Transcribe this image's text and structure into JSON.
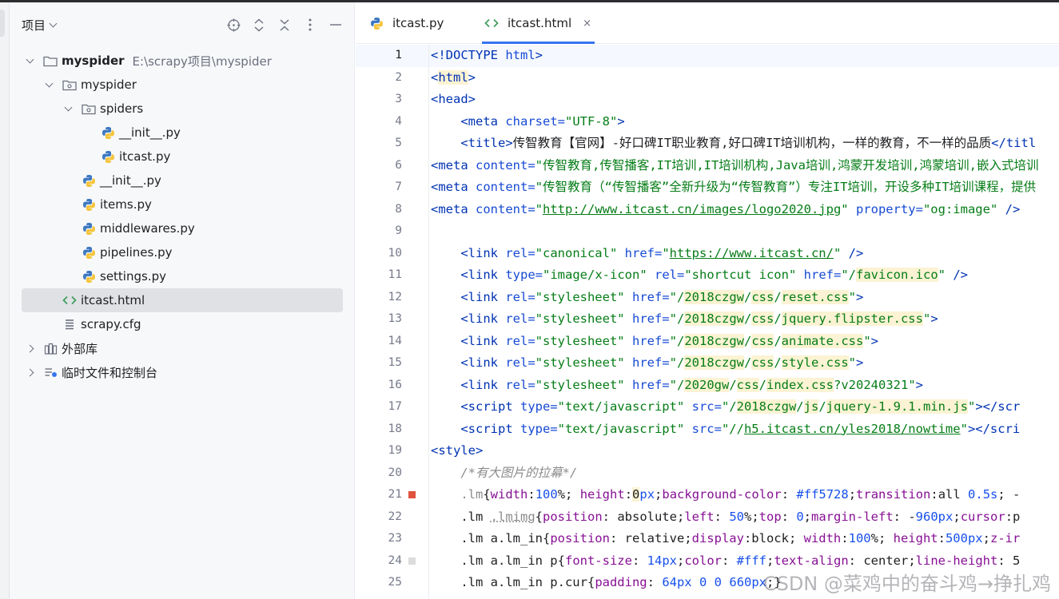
{
  "project_panel": {
    "title": "项目",
    "header_icons": [
      "crosshair-icon",
      "expand-collapse-icon",
      "close-icon",
      "more-icon",
      "minimize-icon"
    ],
    "tree": [
      {
        "label": "myspider",
        "hint": "E:\\scrapy项目\\myspider",
        "type": "folder",
        "expanded": true
      },
      {
        "label": "myspider",
        "type": "package",
        "expanded": true
      },
      {
        "label": "spiders",
        "type": "package",
        "expanded": true
      },
      {
        "label": "__init__.py",
        "type": "python-file"
      },
      {
        "label": "itcast.py",
        "type": "python-file"
      },
      {
        "label": "__init__.py",
        "type": "python-file"
      },
      {
        "label": "items.py",
        "type": "python-file"
      },
      {
        "label": "middlewares.py",
        "type": "python-file"
      },
      {
        "label": "pipelines.py",
        "type": "python-file"
      },
      {
        "label": "settings.py",
        "type": "python-file"
      },
      {
        "label": "itcast.html",
        "type": "html-file",
        "selected": true
      },
      {
        "label": "scrapy.cfg",
        "type": "config-file"
      },
      {
        "label": "外部库",
        "type": "library",
        "expanded": false
      },
      {
        "label": "临时文件和控制台",
        "type": "scratches",
        "expanded": false
      }
    ]
  },
  "tabs": [
    {
      "label": "itcast.py",
      "icon": "python-icon",
      "active": false
    },
    {
      "label": "itcast.html",
      "icon": "html-icon",
      "active": true,
      "close": "×"
    }
  ],
  "editor": {
    "line_numbers": [
      "1",
      "2",
      "3",
      "4",
      "5",
      "6",
      "7",
      "8",
      "9",
      "10",
      "11",
      "12",
      "13",
      "14",
      "15",
      "16",
      "17",
      "18",
      "19",
      "20",
      "21",
      "22",
      "23",
      "24",
      "25"
    ],
    "current_line": 1,
    "breakpoint_colors": {
      "21": "#e0533d",
      "24": "#dcdcdc"
    },
    "code_lines": [
      "<!DOCTYPE html>",
      "<html>",
      "<head>",
      "    <meta charset=\"UTF-8\">",
      "    <title>传智教育【官网】-好口碑IT职业教育,好口碑IT培训机构，一样的教育，不一样的品质</titl",
      "<meta content=\"传智教育,传智播客,IT培训,IT培训机构,Java培训,鸿蒙开发培训,鸿蒙培训,嵌入式培训",
      "<meta content=\"传智教育（“传智播客”全新升级为“传智教育”）专注IT培训，开设多种IT培训课程，提供",
      "<meta content=\"http://www.itcast.cn/images/logo2020.jpg\" property=\"og:image\" />",
      "",
      "    <link rel=\"canonical\" href=\"https://www.itcast.cn/\" />",
      "    <link type=\"image/x-icon\" rel=\"shortcut icon\" href=\"/favicon.ico\" />",
      "    <link rel=\"stylesheet\" href=\"/2018czgw/css/reset.css\">",
      "    <link rel=\"stylesheet\" href=\"/2018czgw/css/jquery.flipster.css\">",
      "    <link rel=\"stylesheet\" href=\"/2018czgw/css/animate.css\">",
      "    <link rel=\"stylesheet\" href=\"/2018czgw/css/style.css\">",
      "    <link rel=\"stylesheet\" href=\"/2020gw/css/index.css?v20240321\">",
      "    <script type=\"text/javascript\" src=\"/2018czgw/js/jquery-1.9.1.min.js\"></scr",
      "    <script type=\"text/javascript\" src=\"//h5.itcast.cn/yles2018/nowtime\"></scri",
      "<style>",
      "    /*有大图片的拉幕*/",
      "    .lm{width:100%; height:0px;background-color: #ff5728;transition:all 0.5s; -",
      "    .lm .lmimg{position: absolute;left: 50%;top: 0;margin-left: -960px;cursor:p",
      "    .lm a.lm_in{position: relative;display:block; width:100%; height:500px;z-ir",
      "    .lm a.lm_in p{font-size: 14px;color: #fff;text-align: center;line-height: 5",
      "    .lm a.lm_in p.cur{padding: 64px 0 0 660px;}"
    ]
  },
  "watermark": "CSDN @菜鸡中的奋斗鸡→挣扎鸡"
}
